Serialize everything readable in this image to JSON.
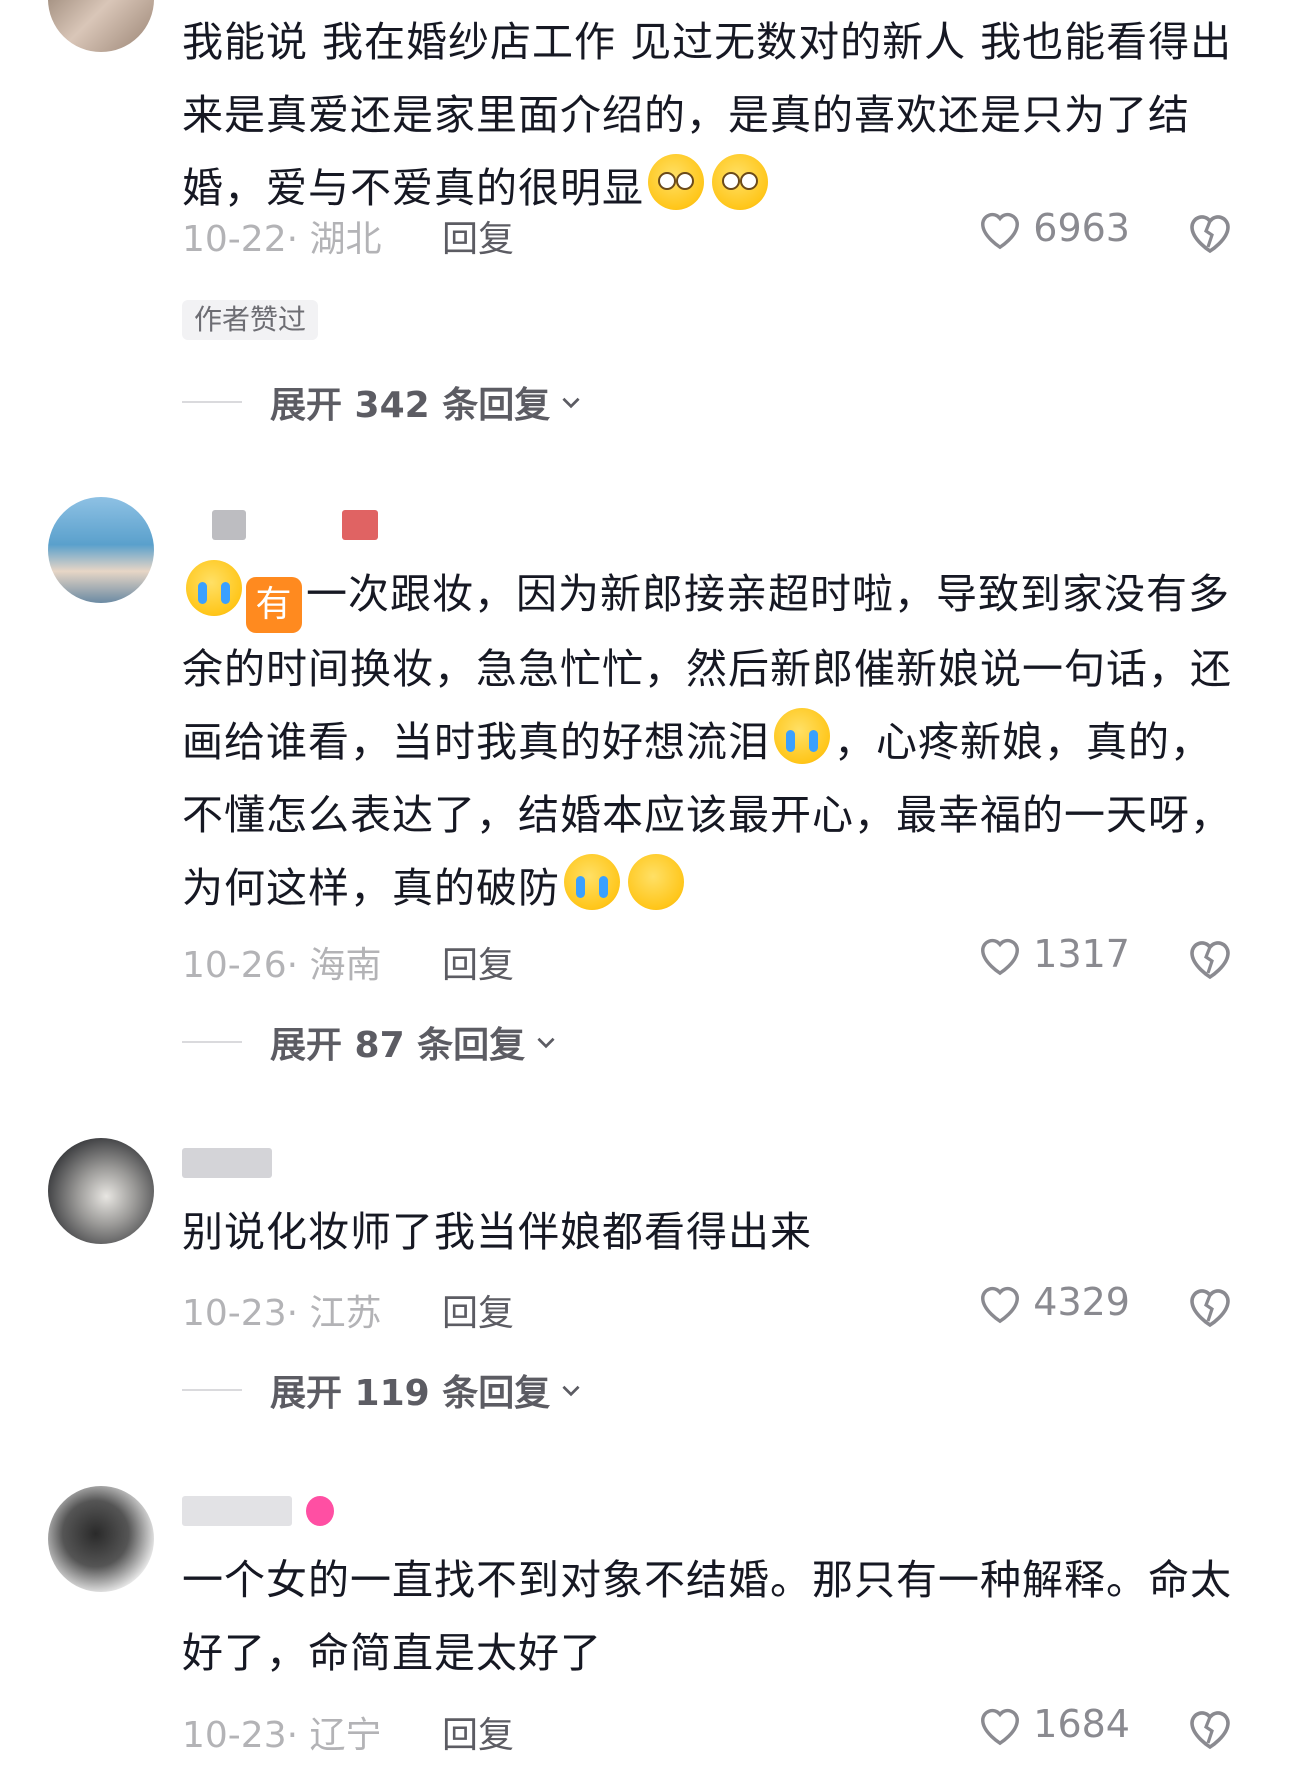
{
  "comments": [
    {
      "text_parts": [
        "我能说 我在婚纱店工作 见过无数对的新人 我也能看得出来是真爱还是家里面介绍的，是真的喜欢还是只为了结婚，爱与不爱真的很明显"
      ],
      "date": "10-22",
      "location": "· 湖北",
      "reply_label": "回复",
      "likes": "6963",
      "author_liked": "作者赞过",
      "expand_label": "展开 342 条回复"
    },
    {
      "prefix_badge": "有",
      "text_parts": [
        "一次跟妆，因为新郎接亲超时啦，导致到家没有多余的时间换妆，急急忙忙，然后新郎催新娘说一句话，还画给谁看，当时我真的好想流泪",
        "，心疼新娘，真的，不懂怎么表达了，结婚本应该最开心，最幸福的一天呀，为何这样，真的破防"
      ],
      "date": "10-26",
      "location": "· 海南",
      "reply_label": "回复",
      "likes": "1317",
      "expand_label": "展开 87 条回复"
    },
    {
      "text_parts": [
        "别说化妆师了我当伴娘都看得出来"
      ],
      "date": "10-23",
      "location": "· 江苏",
      "reply_label": "回复",
      "likes": "4329",
      "expand_label": "展开 119 条回复"
    },
    {
      "text_parts": [
        "一个女的一直找不到对象不结婚。那只有一种解释。命太好了，命简直是太好了"
      ],
      "date": "10-23",
      "location": "· 辽宁",
      "reply_label": "回复",
      "likes": "1684"
    }
  ],
  "icons": {
    "like": "heart-outline-icon",
    "dislike": "broken-heart-icon",
    "chevron": "chevron-down-icon",
    "emoji_flushed": "flushed-face-emoji",
    "emoji_crying": "loudly-crying-face-emoji",
    "emoji_pleading": "face-holding-back-tears-emoji"
  },
  "colors": {
    "text": "#161823",
    "meta": "#b3b3b6",
    "secondary": "#5c5c63",
    "badge": "#ff8a1f"
  }
}
